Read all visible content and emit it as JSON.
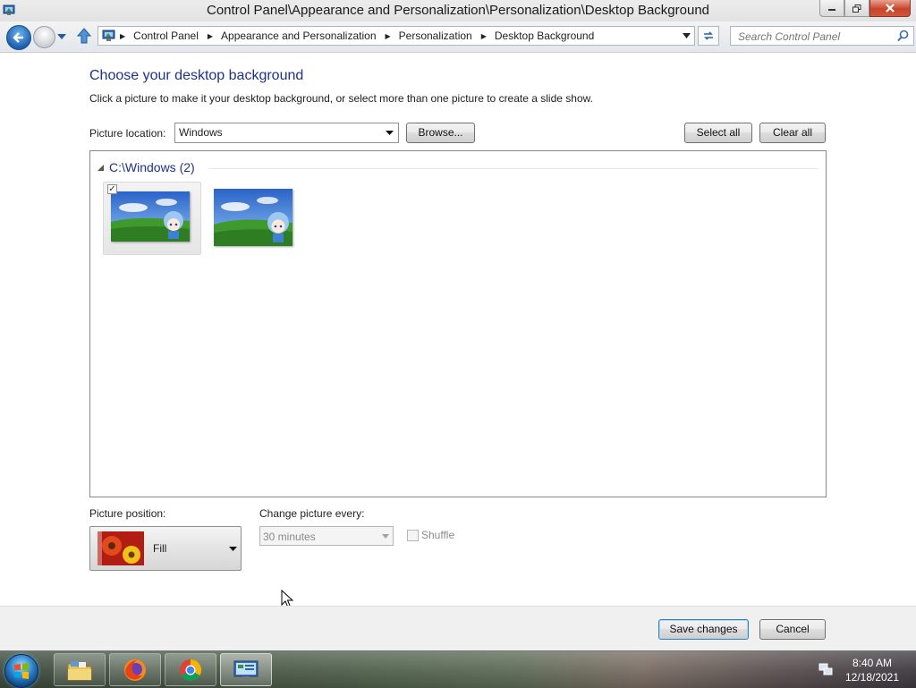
{
  "window": {
    "title": "Control Panel\\Appearance and Personalization\\Personalization\\Desktop Background"
  },
  "address_bar": {
    "crumbs": [
      "Control Panel",
      "Appearance and Personalization",
      "Personalization",
      "Desktop Background"
    ]
  },
  "search": {
    "placeholder": "Search Control Panel"
  },
  "page": {
    "heading": "Choose your desktop background",
    "description": "Click a picture to make it your desktop background, or select more than one picture to create a slide show."
  },
  "picture_location": {
    "label": "Picture location:",
    "value": "Windows",
    "browse_label": "Browse...",
    "select_all_label": "Select all",
    "clear_all_label": "Clear all"
  },
  "gallery": {
    "group_title": "C:\\Windows (2)",
    "thumbnails": [
      {
        "name": "wallpaper-1",
        "checked": true
      },
      {
        "name": "wallpaper-2",
        "checked": false
      }
    ]
  },
  "picture_position": {
    "label": "Picture position:",
    "value": "Fill"
  },
  "slideshow": {
    "change_label": "Change picture every:",
    "interval": "30 minutes",
    "shuffle_label": "Shuffle",
    "shuffle_checked": false,
    "enabled": false
  },
  "footer": {
    "save_label": "Save changes",
    "cancel_label": "Cancel"
  },
  "taskbar": {
    "items": [
      "windows-explorer",
      "firefox",
      "chrome",
      "control-panel"
    ],
    "time": "8:40 AM",
    "date": "12/18/2021"
  },
  "colors": {
    "heading": "#1e3287",
    "accent_button_border": "#3c7fb1",
    "close_button": "#c7452c"
  }
}
